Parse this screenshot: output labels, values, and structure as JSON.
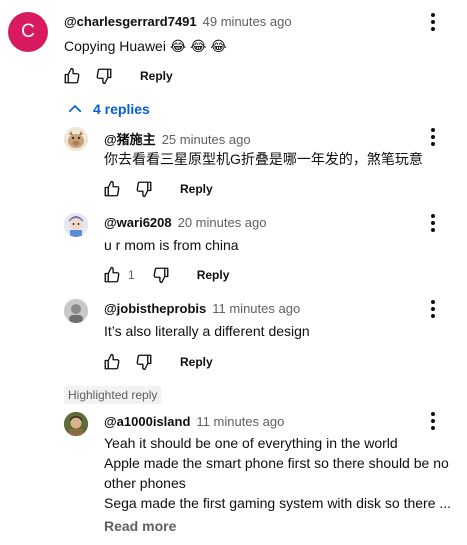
{
  "top_comment": {
    "avatar_letter": "C",
    "handle": "@charlesgerrard7491",
    "time": "49 minutes ago",
    "text": "Copying Huawei 😂 😂 😂",
    "reply_label": "Reply"
  },
  "replies_toggle": {
    "label": "4 replies"
  },
  "replies": [
    {
      "handle": "@猪施主",
      "time": "25 minutes ago",
      "text": "你去看看三星原型机G折叠是哪一年发的，煞笔玩意",
      "likes": "",
      "reply_label": "Reply"
    },
    {
      "handle": "@wari6208",
      "time": "20 minutes ago",
      "text": "u r mom is from china",
      "likes": "1",
      "reply_label": "Reply"
    },
    {
      "handle": "@jobistheprobis",
      "time": "11 minutes ago",
      "text": "It’s also literally a different design",
      "likes": "",
      "reply_label": "Reply"
    }
  ],
  "highlighted": {
    "badge": "Highlighted reply",
    "handle": "@a1000island",
    "time": "11 minutes ago",
    "lines": [
      "Yeah it should be one of everything in the world",
      "Apple made the smart phone first so there should be no",
      "other phones",
      "Sega made the first gaming system with disk so there ..."
    ],
    "read_more": "Read more"
  },
  "colors": {
    "avatar_c": "#d81b60",
    "link_blue": "#065fd4",
    "secondary_text": "#606060"
  }
}
